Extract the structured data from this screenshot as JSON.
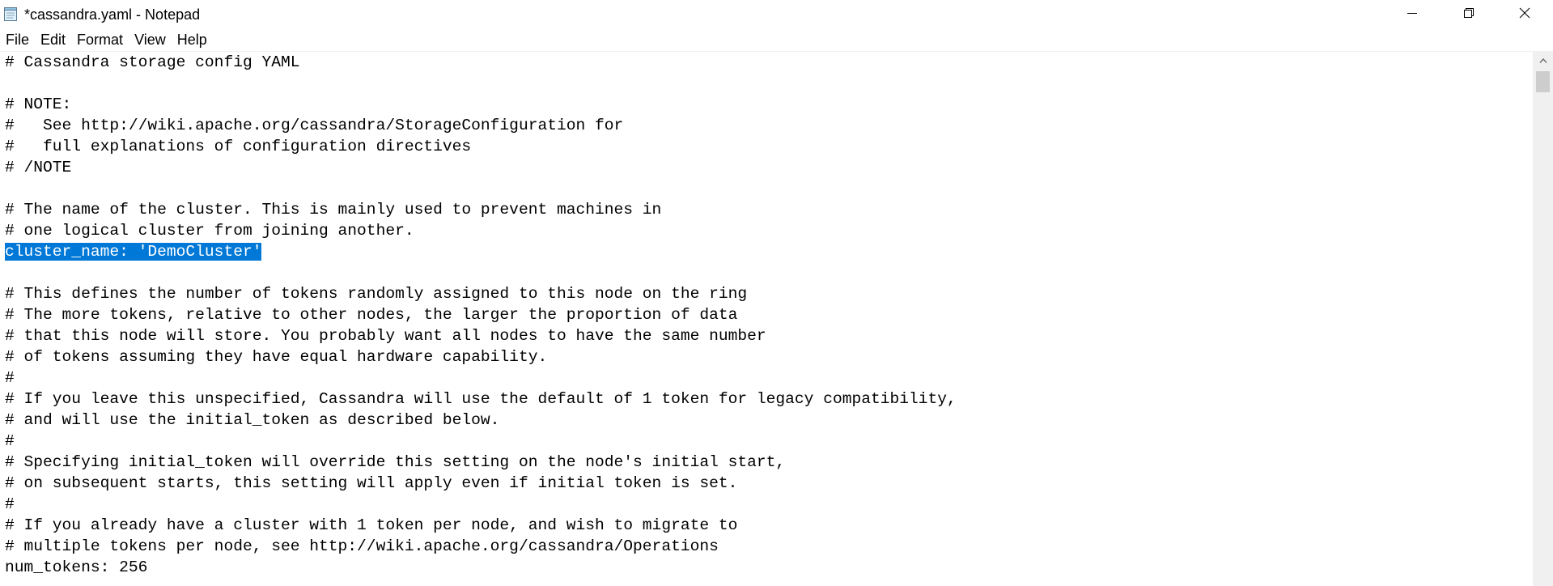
{
  "window": {
    "title": "*cassandra.yaml - Notepad",
    "icons": {
      "app": "notepad-icon",
      "minimize": "minimize-icon",
      "maximize": "restore-icon",
      "close": "close-icon"
    }
  },
  "menu": {
    "items": [
      "File",
      "Edit",
      "Format",
      "View",
      "Help"
    ]
  },
  "editor": {
    "lines": [
      "# Cassandra storage config YAML",
      "",
      "# NOTE:",
      "#   See http://wiki.apache.org/cassandra/StorageConfiguration for",
      "#   full explanations of configuration directives",
      "# /NOTE",
      "",
      "# The name of the cluster. This is mainly used to prevent machines in",
      "# one logical cluster from joining another.",
      "cluster_name: 'DemoCluster'",
      "",
      "# This defines the number of tokens randomly assigned to this node on the ring",
      "# The more tokens, relative to other nodes, the larger the proportion of data",
      "# that this node will store. You probably want all nodes to have the same number",
      "# of tokens assuming they have equal hardware capability.",
      "#",
      "# If you leave this unspecified, Cassandra will use the default of 1 token for legacy compatibility,",
      "# and will use the initial_token as described below.",
      "#",
      "# Specifying initial_token will override this setting on the node's initial start,",
      "# on subsequent starts, this setting will apply even if initial token is set.",
      "#",
      "# If you already have a cluster with 1 token per node, and wish to migrate to",
      "# multiple tokens per node, see http://wiki.apache.org/cassandra/Operations",
      "num_tokens: 256"
    ],
    "selected_line_index": 9,
    "selection_color": "#0078d7"
  },
  "scrollbar": {
    "up_icon": "scroll-up-arrow-icon"
  }
}
